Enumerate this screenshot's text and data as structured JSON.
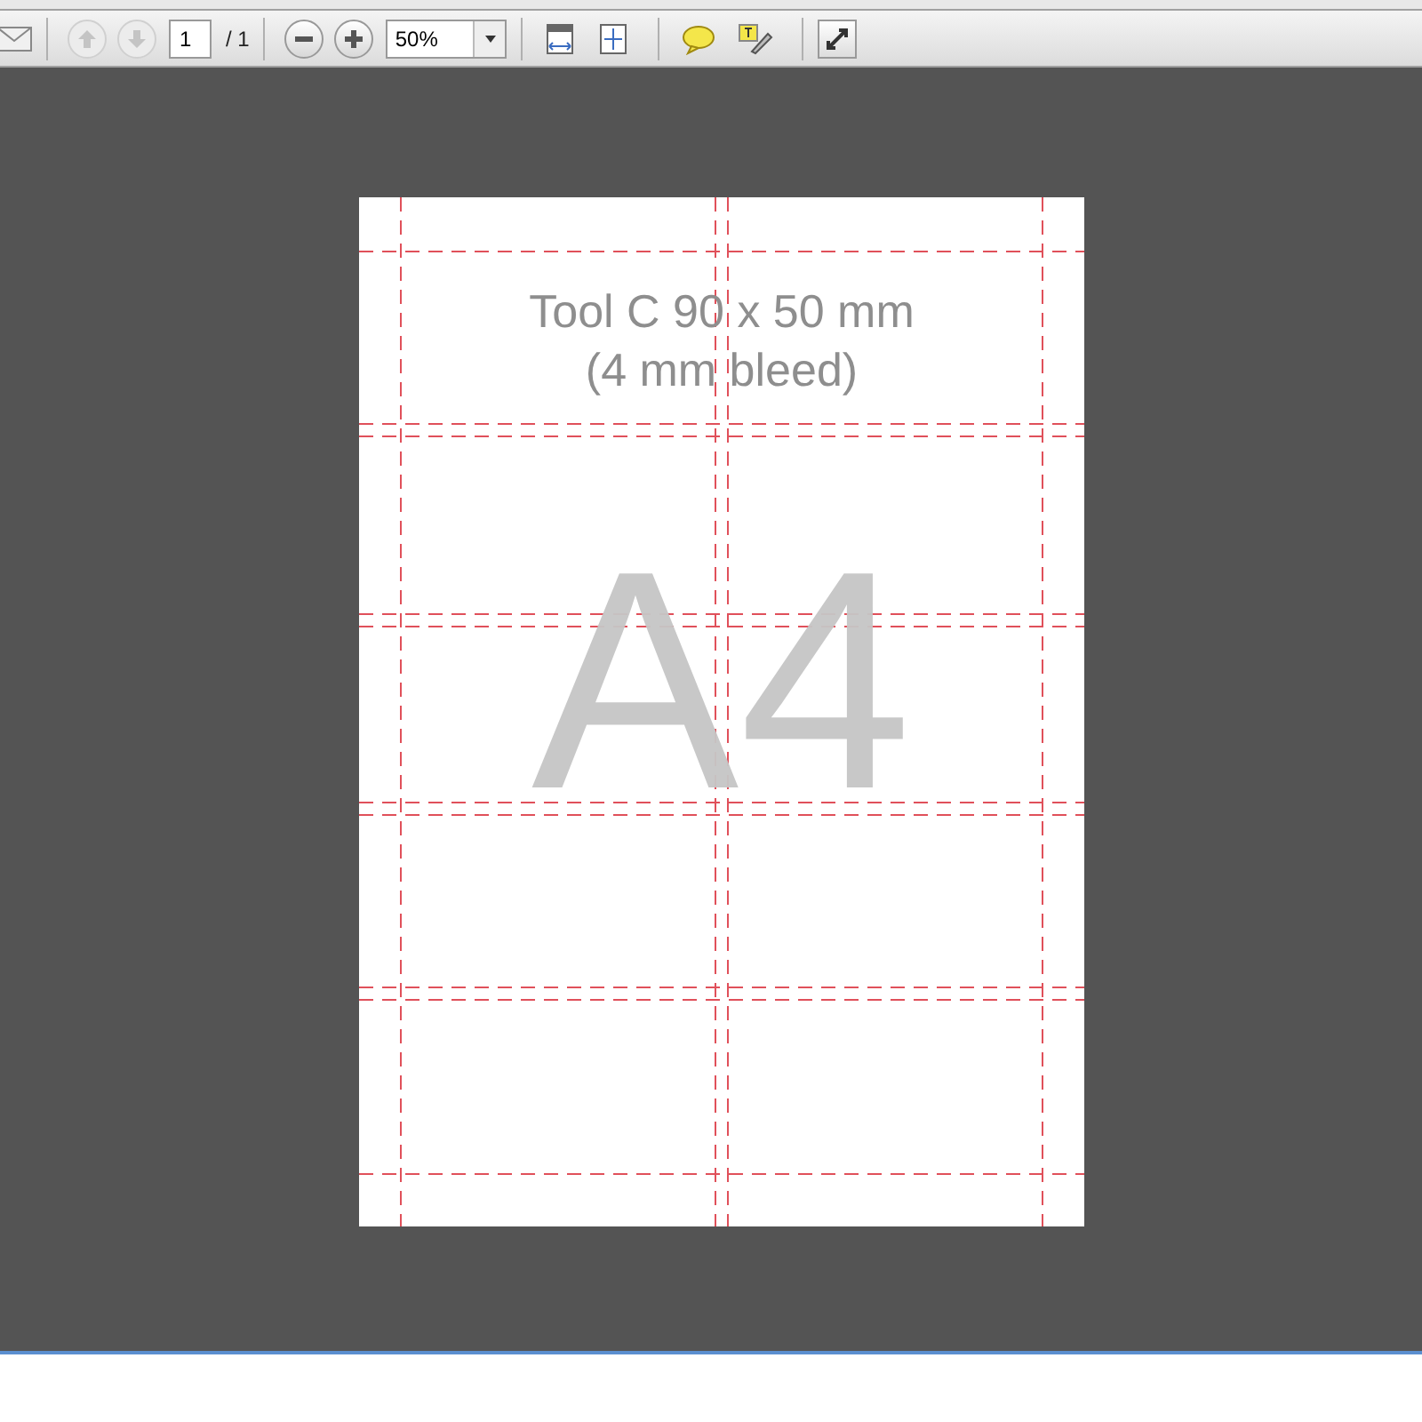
{
  "toolbar": {
    "page_nav": [
      {
        "kind": "previous",
        "disabled": true
      },
      {
        "kind": "next",
        "disabled": true
      }
    ],
    "page_field": {
      "value": "1"
    },
    "page_count": "/ 1",
    "zoom_field": {
      "value": "50%"
    }
  },
  "document": {
    "title_lines": [
      "Tool C 90 x 50 mm",
      "(4 mm bleed)"
    ],
    "format_label": "A4"
  }
}
